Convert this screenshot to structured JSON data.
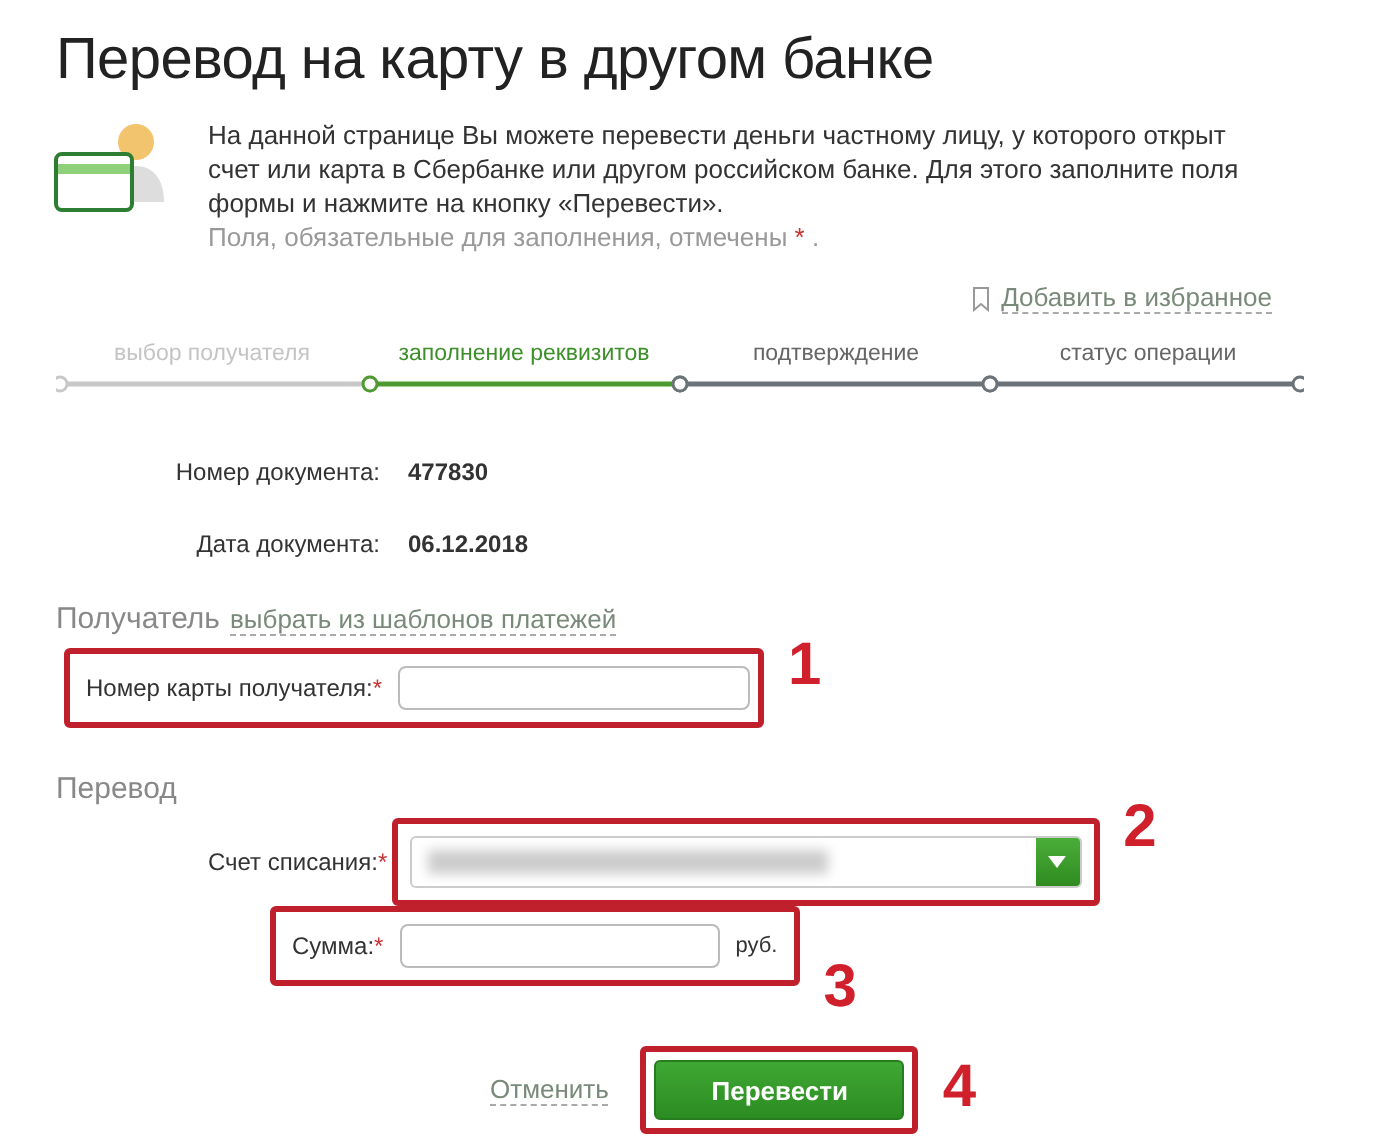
{
  "title": "Перевод на карту в другом банке",
  "intro": {
    "text": "На данной странице Вы можете перевести деньги частному лицу, у которого открыт счет или карта в Сбербанке или другом российском банке. Для этого заполните поля формы и нажмите на кнопку «Перевести».",
    "required_note": "Поля, обязательные для заполнения, отмечены",
    "required_mark": "*",
    "note_end": "."
  },
  "favorite_link": "Добавить в избранное",
  "steps": [
    {
      "label": "выбор получателя",
      "done": true,
      "selected": false
    },
    {
      "label": "заполнение реквизитов",
      "done": false,
      "selected": true
    },
    {
      "label": "подтверждение",
      "done": false,
      "selected": false
    },
    {
      "label": "статус операции",
      "done": false,
      "selected": false
    }
  ],
  "document": [
    {
      "label": "Номер документа:",
      "value": "477830"
    },
    {
      "label": "Дата документа:",
      "value": "06.12.2018"
    }
  ],
  "recipient": {
    "heading": "Получатель",
    "templates_link": "выбрать из шаблонов платежей",
    "card_field": {
      "label": "Номер карты получателя:",
      "required_mark": "*",
      "callout": "1"
    }
  },
  "transfer": {
    "heading": "Перевод",
    "account_field": {
      "label": "Счет списания:",
      "required_mark": "*",
      "callout": "2"
    },
    "amount_field": {
      "label": "Сумма:",
      "required_mark": "*",
      "unit": "руб.",
      "callout": "3"
    }
  },
  "actions": {
    "cancel": "Отменить",
    "submit": "Перевести",
    "submit_callout": "4"
  }
}
